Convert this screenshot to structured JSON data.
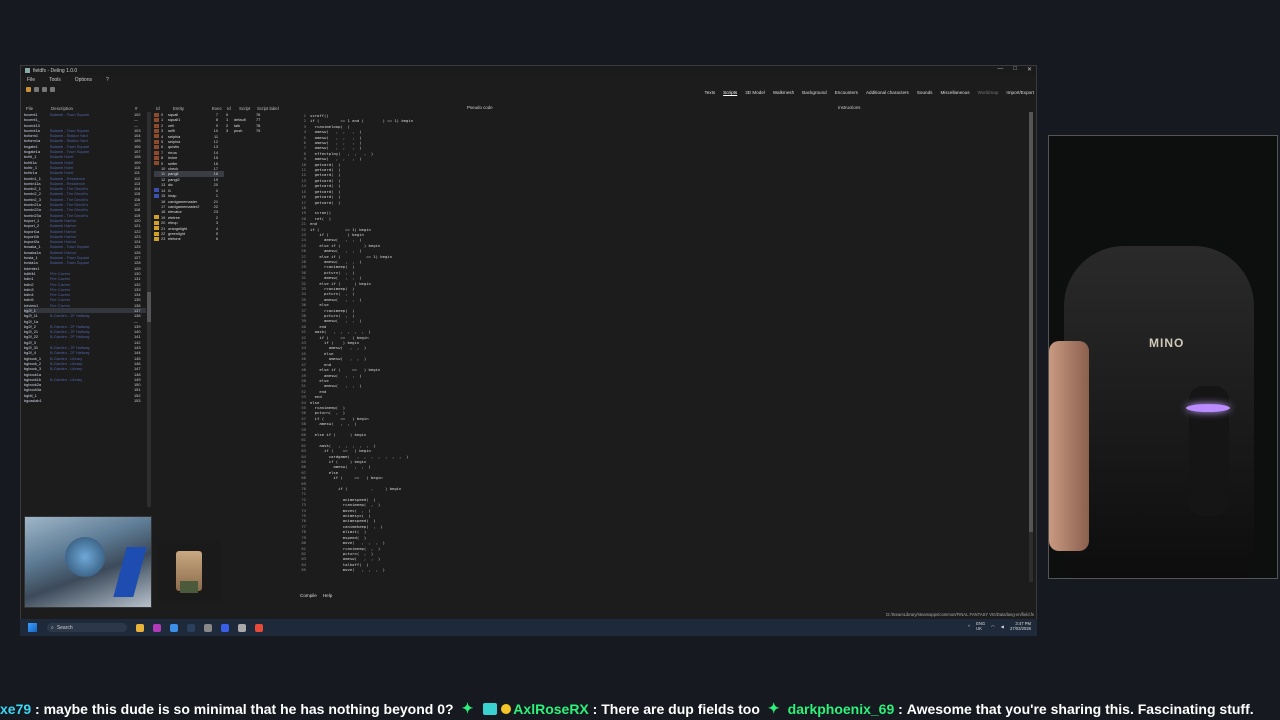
{
  "window": {
    "title": "fieldfs - Deling 1.0.0",
    "controls": [
      "—",
      "□",
      "✕"
    ],
    "menu": [
      "File",
      "Tools",
      "Options",
      "?"
    ],
    "tabs": [
      "Texts",
      "Scripts",
      "3D Model",
      "Walkmesh",
      "Background",
      "Encounters",
      "Additional characters",
      "Sounds",
      "Miscellaneous",
      "Worldmap",
      "Import/Export"
    ],
    "active_tab": "Scripts"
  },
  "file_panel": {
    "headers": {
      "file": "File",
      "desc": "Description",
      "num": "#"
    },
    "rows": [
      {
        "name": "bccent1",
        "desc": "Balamb - Town Square",
        "num": "102"
      },
      {
        "name": "bccent1_",
        "desc": "",
        "num": "—"
      },
      {
        "name": "bccent13",
        "desc": "",
        "num": "—"
      },
      {
        "name": "bccent1a",
        "desc": "Balamb - Town Square",
        "num": "103"
      },
      {
        "name": "bcform1",
        "desc": "Balamb - Station Yard",
        "num": "104"
      },
      {
        "name": "bcform1a",
        "desc": "Balamb - Station Yard",
        "num": "105"
      },
      {
        "name": "bcgate1",
        "desc": "Balamb - Town Square",
        "num": "106"
      },
      {
        "name": "bcgate1a",
        "desc": "Balamb - Town Square",
        "num": "107"
      },
      {
        "name": "bchtl_1",
        "desc": "Balamb Hotel",
        "num": "108"
      },
      {
        "name": "bchtl1a",
        "desc": "Balamb Hotel",
        "num": "109"
      },
      {
        "name": "bchtr_1",
        "desc": "Balamb Hotel",
        "num": "110"
      },
      {
        "name": "bchtr1a",
        "desc": "Balamb Hotel",
        "num": "111"
      },
      {
        "name": "bcmin1_1",
        "desc": "Balamb - Residence",
        "num": "112"
      },
      {
        "name": "bcmin11a",
        "desc": "Balamb - Residence",
        "num": "113"
      },
      {
        "name": "bcmin2_1",
        "desc": "Balamb - The Dincht's",
        "num": "114"
      },
      {
        "name": "bcmin2_2",
        "desc": "Balamb - The Dincht's",
        "num": "115"
      },
      {
        "name": "bcmin2_3",
        "desc": "Balamb - The Dincht's",
        "num": "116"
      },
      {
        "name": "bcmin21a",
        "desc": "Balamb - The Dincht's",
        "num": "117"
      },
      {
        "name": "bcmin22a",
        "desc": "Balamb - The Dincht's",
        "num": "118"
      },
      {
        "name": "bcmin23a",
        "desc": "Balamb - The Dincht's",
        "num": "119"
      },
      {
        "name": "bcport_1",
        "desc": "Balamb Harbor",
        "num": "120"
      },
      {
        "name": "bcport_2",
        "desc": "Balamb Harbor",
        "num": "121"
      },
      {
        "name": "bcport1a",
        "desc": "Balamb Harbor",
        "num": "122"
      },
      {
        "name": "bcport1b",
        "desc": "Balamb Harbor",
        "num": "123"
      },
      {
        "name": "bcport2a",
        "desc": "Balamb Harbor",
        "num": "124"
      },
      {
        "name": "bcsaka_1",
        "desc": "Balamb - Town Square",
        "num": "125"
      },
      {
        "name": "bcsaka1a",
        "desc": "Balamb Harbor",
        "num": "126"
      },
      {
        "name": "bcsta_1",
        "desc": "Balamb - Town Square",
        "num": "127"
      },
      {
        "name": "bcsta1a",
        "desc": "Balamb - Town Square",
        "num": "128"
      },
      {
        "name": "bdenter1",
        "desc": "",
        "num": "129"
      },
      {
        "name": "bdifrit1",
        "desc": "Fire Cavern",
        "num": "130"
      },
      {
        "name": "bdin1",
        "desc": "Fire Cavern",
        "num": "131"
      },
      {
        "name": "bdin2",
        "desc": "Fire Cavern",
        "num": "132"
      },
      {
        "name": "bdin3",
        "desc": "Fire Cavern",
        "num": "133"
      },
      {
        "name": "bdin4",
        "desc": "Fire Cavern",
        "num": "134"
      },
      {
        "name": "bdin5",
        "desc": "Fire Cavern",
        "num": "135"
      },
      {
        "name": "bdview1",
        "desc": "Fire Cavern",
        "num": "136"
      },
      {
        "name": "bg2f_1",
        "desc": "",
        "num": "137"
      },
      {
        "name": "bg2f_11",
        "desc": "B-Garden - 2F Hallway",
        "num": "138"
      },
      {
        "name": "bg2f_1a",
        "desc": "",
        "num": "—"
      },
      {
        "name": "bg2f_2",
        "desc": "B-Garden - 2F Hallway",
        "num": "139"
      },
      {
        "name": "bg2f_21",
        "desc": "B-Garden - 2F Hallway",
        "num": "140"
      },
      {
        "name": "bg2f_22",
        "desc": "B-Garden - 2F Hallway",
        "num": "141"
      },
      {
        "name": "bg2f_3",
        "desc": "",
        "num": "142"
      },
      {
        "name": "bg2f_31",
        "desc": "B-Garden - 2F Hallway",
        "num": "143"
      },
      {
        "name": "bg2f_4",
        "desc": "B-Garden - 2F Hallway",
        "num": "144"
      },
      {
        "name": "bgbook_1",
        "desc": "B-Garden - Library",
        "num": "145"
      },
      {
        "name": "bgbook_2",
        "desc": "B-Garden - Library",
        "num": "146"
      },
      {
        "name": "bgbook_3",
        "desc": "B-Garden - Library",
        "num": "147"
      },
      {
        "name": "bgbook1a",
        "desc": "",
        "num": "148"
      },
      {
        "name": "bgbook1b",
        "desc": "B-Garden - Library",
        "num": "149"
      },
      {
        "name": "bgbook2a",
        "desc": "",
        "num": "150"
      },
      {
        "name": "bgbook3a",
        "desc": "",
        "num": "151"
      },
      {
        "name": "bgbtl_1",
        "desc": "",
        "num": "152"
      },
      {
        "name": "bgcaslab1",
        "desc": "",
        "num": "153"
      }
    ],
    "selected_index": 37
  },
  "entity_panel": {
    "headers": {
      "id": "Id",
      "entity": "Entity",
      "exec": "Exec"
    },
    "rows": [
      {
        "id": "0",
        "name": "squall",
        "count": "7",
        "color": "#8b4a2b"
      },
      {
        "id": "1",
        "name": "squall1",
        "count": "8",
        "color": "#8b4a2b"
      },
      {
        "id": "2",
        "name": "zell",
        "count": "9",
        "color": "#8b4a2b"
      },
      {
        "id": "3",
        "name": "selfi",
        "count": "10",
        "color": "#8b4a2b"
      },
      {
        "id": "4",
        "name": "selphia",
        "count": "11",
        "color": "#8b4a2b"
      },
      {
        "id": "5",
        "name": "selphia",
        "count": "12",
        "color": "#8b4a2b"
      },
      {
        "id": "6",
        "name": "quistis",
        "count": "13",
        "color": "#8b4a2b"
      },
      {
        "id": "7",
        "name": "rinoa",
        "count": "14",
        "color": "#8b4a2b"
      },
      {
        "id": "8",
        "name": "irvine",
        "count": "15",
        "color": "#8b4a2b"
      },
      {
        "id": "9",
        "name": "seifer",
        "count": "16",
        "color": "#8b4a2b"
      },
      {
        "id": "10",
        "name": "check",
        "count": "17",
        "color": ""
      },
      {
        "id": "11",
        "name": "pangil",
        "count": "18",
        "color": ""
      },
      {
        "id": "12",
        "name": "pangi2",
        "count": "19",
        "color": ""
      },
      {
        "id": "13",
        "name": "dic",
        "count": "20",
        "color": ""
      },
      {
        "id": "14",
        "name": "l1",
        "count": "0",
        "color": "#3a4fb0"
      },
      {
        "id": "15",
        "name": "lmap",
        "count": "1",
        "color": "#3a4fb0"
      },
      {
        "id": "16",
        "name": "cardgamemaster",
        "count": "21",
        "color": ""
      },
      {
        "id": "17",
        "name": "cardgamemaster2",
        "count": "22",
        "color": ""
      },
      {
        "id": "18",
        "name": "elevator",
        "count": "23",
        "color": ""
      },
      {
        "id": "19",
        "name": "eletree",
        "count": "2",
        "color": "#d1a02b"
      },
      {
        "id": "20",
        "name": "eleup",
        "count": "3",
        "color": "#d1a02b"
      },
      {
        "id": "21",
        "name": "orangelight",
        "count": "4",
        "color": "#d1a02b"
      },
      {
        "id": "22",
        "name": "greenlight",
        "count": "5",
        "color": "#d1a02b"
      },
      {
        "id": "23",
        "name": "eletone",
        "count": "6",
        "color": "#d1a02b"
      }
    ],
    "selected_index": 11
  },
  "script_panel": {
    "headers": {
      "id": "Id",
      "script": "Script",
      "label": "Script label"
    },
    "rows": [
      {
        "id": "0",
        "name": "",
        "label": "76"
      },
      {
        "id": "1",
        "name": "default",
        "label": "77"
      },
      {
        "id": "2",
        "name": "talk",
        "label": "78"
      },
      {
        "id": "3",
        "name": "push",
        "label": "79"
      }
    ]
  },
  "pseudo_label": "Pseudo code",
  "instructions_label": "Instructions",
  "code_lines": [
    "scroff()",
    "if (         == 1 and (        ) == 1) begin",
    "  rcanimeloop(  )",
    "  amesw(   ,  ,   ,  )",
    "  amesw(   ,  ,   ,  )",
    "  amesw(   ,  ,   ,  )",
    "  amesw(   ,  ,   ,  )",
    "  effectplay(   ,  ,   ,  )",
    "  amesw(   ,  ,   ,  )",
    "  getcard(  )",
    "  getcard(  )",
    "  getcard(  )",
    "  getcard(  )",
    "  getcard(  )",
    "  getcard(  )",
    "  getcard(  )",
    "  getcard(  )",
    "",
    "  scron()",
    "  ret(  )",
    "end",
    "if (           == 1) begin",
    "    if (        ) begin",
    "      amesw(   ,  ,  )",
    "    else if (          ) begin",
    "      amesw(   ,  ,  )",
    "    else if (           == 1) begin",
    "      amesw(   ,  ,  )",
    "      rcanimeep(  )",
    "      pcturn(  ,  )",
    "      amesw(   ,  ,  )",
    "    else if (      ) begin",
    "      rcanimeep(  )",
    "      pcturn(  ,  )",
    "      amesw(   ,  ,  )",
    "    else",
    "      rcanimeep(  )",
    "      pcturn(  ,  )",
    "      amesw(   ,  ,  )",
    "    end",
    "  aask(   ,  ,  ,  ,  ,  )",
    "    if (     ==   ) begin",
    "      if (    ) begin",
    "        amesw(   ,  ,  )",
    "      else",
    "        amesw(   ,  ,  )",
    "      end",
    "    else if (     ==   ) begin",
    "      amesw(   ,  ,  )",
    "    else",
    "      amesw(   ,  ,  )",
    "    end",
    "  end",
    "else",
    "  rcanimeep(  )",
    "  pcturn(  ,  )",
    "  if (       ==   ) begin",
    "    amesw(   ,  ,  )",
    "    ",
    "  else if (      ) begin",
    "    ",
    "    aask(   ,  ,  ,  ,  ,  )",
    "      if (    ==   ) begin",
    "        cardgame(   ,  ,  ,  ,  ,  ,  ,  )",
    "        if (     ) begin",
    "          amesw(   ,  ,  )",
    "        else",
    "          if (     ==   ) begin",
    "            ",
    "            if (          ,     ) begin",
    "              ",
    "              animespeed(  )",
    "              rcanimeep(  ,  )",
    "              movev(  ,  )",
    "              animesyc(  )",
    "              animespeed(  )",
    "              canimekeep(  ,  )",
    "              mlimit(  )",
    "              mspeed(  )",
    "              move(   ,  ,  ,  )",
    "              rcanimeep(  ,  )",
    "              pcturn(  ,  )",
    "              amesw(   ,  ,  )",
    "              talkoff(  )",
    "              move(   ,  ,  ,  )"
  ],
  "compile_bar": [
    "Compile",
    "Help"
  ],
  "path": "D:/SteamLibrary/steamapps/common/FINAL FANTASY VIII/Data/lang-en/field.fs",
  "taskbar": {
    "search_placeholder": "Search",
    "lang": "ENG\nUK",
    "time": "3:47 PM",
    "date": "27/03/2026"
  },
  "webcam": {
    "chair_text": "MINO"
  },
  "chat": {
    "msg1_user": "xe79",
    "msg1_text": "maybe this dude is so minimal that he has nothing beyond 0?",
    "msg2_user": "AxlRoseRX",
    "msg2_text": "There are dup fields too",
    "msg3_user": "darkphoenix_69",
    "msg3_text": "Awesome that you're sharing this. Fascinating stuff."
  }
}
